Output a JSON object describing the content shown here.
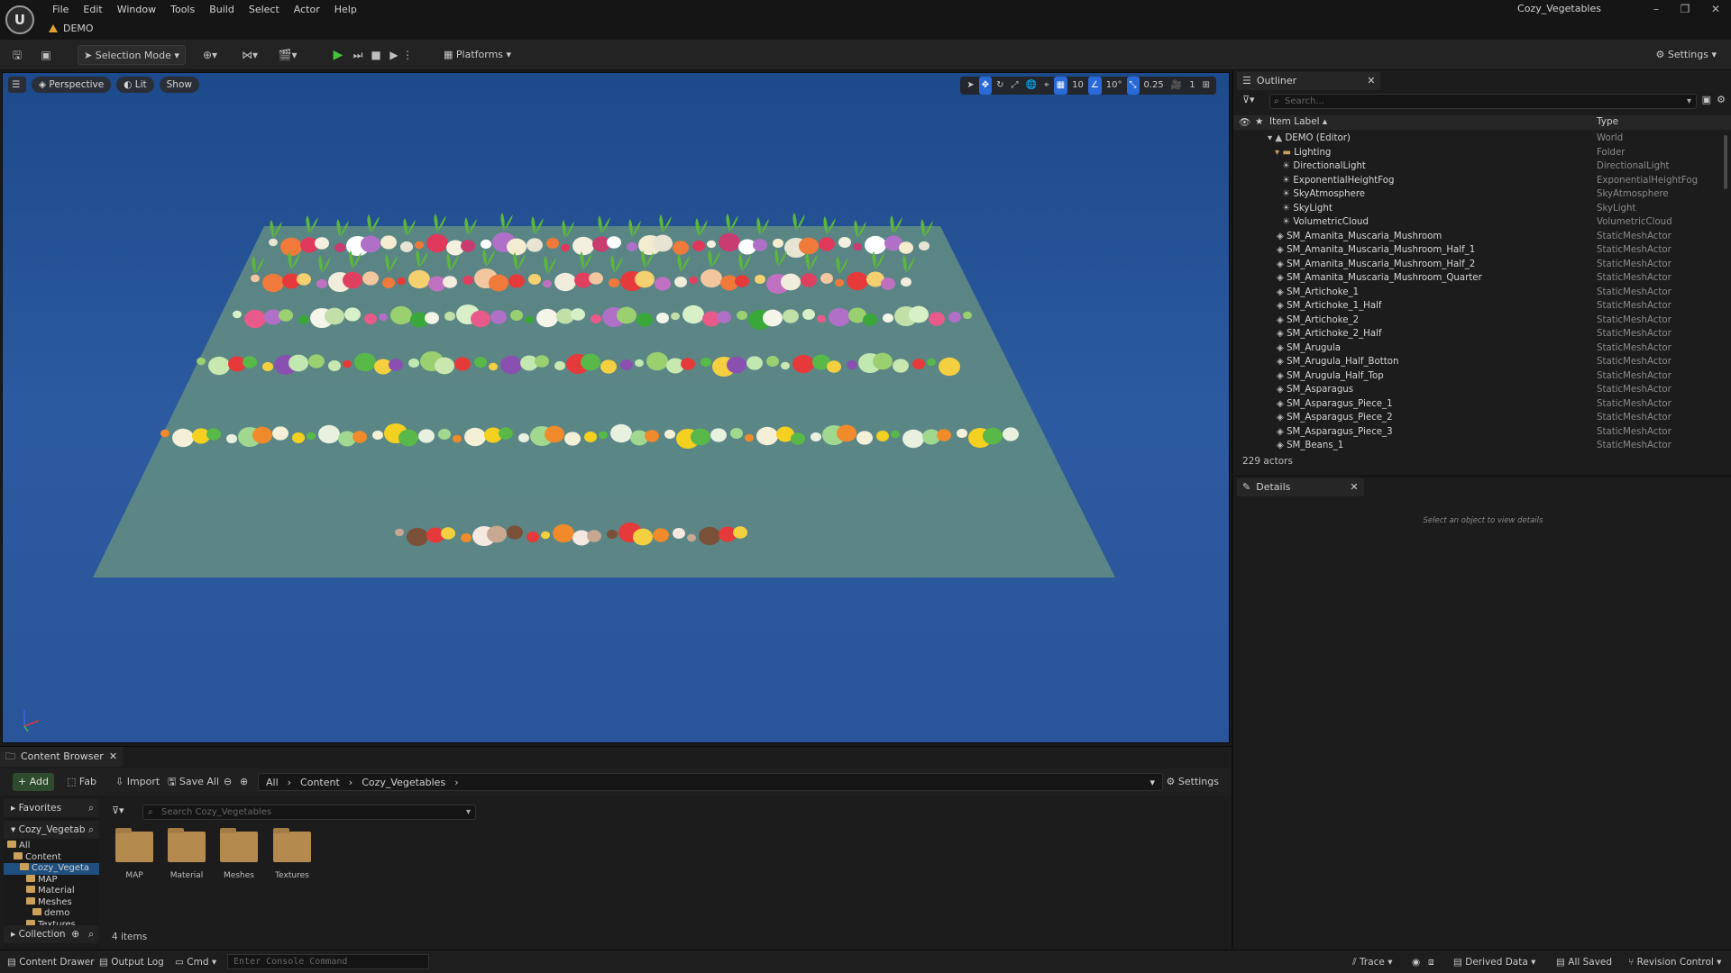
{
  "menu": [
    "File",
    "Edit",
    "Window",
    "Tools",
    "Build",
    "Select",
    "Actor",
    "Help"
  ],
  "level_tab": "DEMO",
  "project_title": "Cozy_Vegetables",
  "toolbar": {
    "selection_mode": "Selection Mode",
    "platforms": "Platforms",
    "settings": "Settings"
  },
  "viewport": {
    "perspective": "Perspective",
    "lit": "Lit",
    "show": "Show",
    "grid_snap": "10",
    "rot_snap": "10°",
    "scale_snap": "0.25",
    "camera_speed": "1"
  },
  "outliner": {
    "tab": "Outliner",
    "search_placeholder": "Search...",
    "col_label": "Item Label",
    "col_type": "Type",
    "rows": [
      {
        "label": "DEMO (Editor)",
        "type": "World",
        "depth": 0,
        "kind": "world"
      },
      {
        "label": "Lighting",
        "type": "Folder",
        "depth": 1,
        "kind": "folder"
      },
      {
        "label": "DirectionalLight",
        "type": "DirectionalLight",
        "depth": 2,
        "kind": "light"
      },
      {
        "label": "ExponentialHeightFog",
        "type": "ExponentialHeightFog",
        "depth": 2,
        "kind": "light"
      },
      {
        "label": "SkyAtmosphere",
        "type": "SkyAtmosphere",
        "depth": 2,
        "kind": "light"
      },
      {
        "label": "SkyLight",
        "type": "SkyLight",
        "depth": 2,
        "kind": "light"
      },
      {
        "label": "VolumetricCloud",
        "type": "VolumetricCloud",
        "depth": 2,
        "kind": "light"
      },
      {
        "label": "SM_Amanita_Muscaria_Mushroom",
        "type": "StaticMeshActor",
        "depth": 1,
        "kind": "mesh"
      },
      {
        "label": "SM_Amanita_Muscaria_Mushroom_Half_1",
        "type": "StaticMeshActor",
        "depth": 1,
        "kind": "mesh"
      },
      {
        "label": "SM_Amanita_Muscaria_Mushroom_Half_2",
        "type": "StaticMeshActor",
        "depth": 1,
        "kind": "mesh"
      },
      {
        "label": "SM_Amanita_Muscaria_Mushroom_Quarter",
        "type": "StaticMeshActor",
        "depth": 1,
        "kind": "mesh"
      },
      {
        "label": "SM_Artichoke_1",
        "type": "StaticMeshActor",
        "depth": 1,
        "kind": "mesh"
      },
      {
        "label": "SM_Artichoke_1_Half",
        "type": "StaticMeshActor",
        "depth": 1,
        "kind": "mesh"
      },
      {
        "label": "SM_Artichoke_2",
        "type": "StaticMeshActor",
        "depth": 1,
        "kind": "mesh"
      },
      {
        "label": "SM_Artichoke_2_Half",
        "type": "StaticMeshActor",
        "depth": 1,
        "kind": "mesh"
      },
      {
        "label": "SM_Arugula",
        "type": "StaticMeshActor",
        "depth": 1,
        "kind": "mesh"
      },
      {
        "label": "SM_Arugula_Half_Botton",
        "type": "StaticMeshActor",
        "depth": 1,
        "kind": "mesh"
      },
      {
        "label": "SM_Arugula_Half_Top",
        "type": "StaticMeshActor",
        "depth": 1,
        "kind": "mesh"
      },
      {
        "label": "SM_Asparagus",
        "type": "StaticMeshActor",
        "depth": 1,
        "kind": "mesh"
      },
      {
        "label": "SM_Asparagus_Piece_1",
        "type": "StaticMeshActor",
        "depth": 1,
        "kind": "mesh"
      },
      {
        "label": "SM_Asparagus_Piece_2",
        "type": "StaticMeshActor",
        "depth": 1,
        "kind": "mesh"
      },
      {
        "label": "SM_Asparagus_Piece_3",
        "type": "StaticMeshActor",
        "depth": 1,
        "kind": "mesh"
      },
      {
        "label": "SM_Beans_1",
        "type": "StaticMeshActor",
        "depth": 1,
        "kind": "mesh"
      }
    ],
    "actor_count": "229 actors"
  },
  "details": {
    "tab": "Details",
    "hint": "Select an object to view details"
  },
  "content_browser": {
    "tab": "Content Browser",
    "add": "Add",
    "fab": "Fab",
    "import": "Import",
    "save_all": "Save All",
    "path": [
      "All",
      "Content",
      "Cozy_Vegetables"
    ],
    "settings": "Settings",
    "favorites": "Favorites",
    "source_root": "Cozy_Vegetab",
    "tree": [
      {
        "label": "All",
        "depth": 0
      },
      {
        "label": "Content",
        "depth": 1
      },
      {
        "label": "Cozy_Vegeta",
        "depth": 2,
        "selected": true
      },
      {
        "label": "MAP",
        "depth": 3
      },
      {
        "label": "Material",
        "depth": 3
      },
      {
        "label": "Meshes",
        "depth": 3
      },
      {
        "label": "demo",
        "depth": 4
      },
      {
        "label": "Textures",
        "depth": 3
      }
    ],
    "collections": "Collection",
    "search_placeholder": "Search Cozy_Vegetables",
    "assets": [
      "MAP",
      "Material",
      "Meshes",
      "Textures"
    ],
    "item_count": "4 items"
  },
  "statusbar": {
    "content_drawer": "Content Drawer",
    "output_log": "Output Log",
    "cmd": "Cmd",
    "console_placeholder": "Enter Console Command",
    "trace": "Trace",
    "derived_data": "Derived Data",
    "all_saved": "All Saved",
    "revision_control": "Revision Control"
  }
}
